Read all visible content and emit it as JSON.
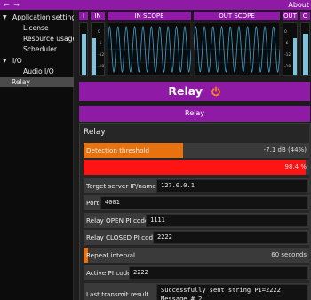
{
  "topbar": {
    "nav": "← →",
    "about": "About"
  },
  "sidebar": {
    "items": [
      {
        "label": "Application settings",
        "chevron": "▼"
      },
      {
        "label": "License"
      },
      {
        "label": "Resource usage"
      },
      {
        "label": "Scheduler"
      },
      {
        "label": "I/O",
        "chevron": "▼"
      },
      {
        "label": "Audio I/O"
      },
      {
        "label": "Relay"
      }
    ]
  },
  "meters": {
    "labels": [
      "I",
      "IN",
      "IN SCOPE",
      "OUT SCOPE",
      "OUT",
      "O"
    ],
    "scale": [
      "0",
      "-6",
      "-12",
      "-18"
    ],
    "levels": {
      "I": 0.8,
      "IN": 0.72,
      "OUT": 0.72,
      "O": 0.8
    },
    "bar_color": "#7ec4dc",
    "wave_color": "#3aa0d0"
  },
  "relay": {
    "title": "Relay",
    "tab": "Relay",
    "panel_title": "Relay",
    "power_icon": "power-icon",
    "accent": "#8e1aa6",
    "detection": {
      "label": "Detection threshold",
      "value": "-7.1 dB (44%)",
      "level": 0.44,
      "color": "#e8730e"
    },
    "signal": {
      "value": "98.4 %",
      "level": 0.984,
      "color": "#ff1414"
    },
    "fields": {
      "target": {
        "label": "Target server IP/name",
        "value": "127.0.0.1"
      },
      "port": {
        "label": "Port",
        "value": "4001"
      },
      "open": {
        "label": "Relay OPEN PI code",
        "value": "1111"
      },
      "closed": {
        "label": "Relay CLOSED PI code",
        "value": "2222"
      },
      "active": {
        "label": "Active PI code",
        "value": "2222"
      },
      "last": {
        "label": "Last transmit result",
        "value": "Successfully sent string PI=2222\nMessage # 2"
      }
    },
    "repeat": {
      "label": "Repeat interval",
      "value": "60 seconds",
      "level": 0.02,
      "color": "#e8730e"
    }
  }
}
